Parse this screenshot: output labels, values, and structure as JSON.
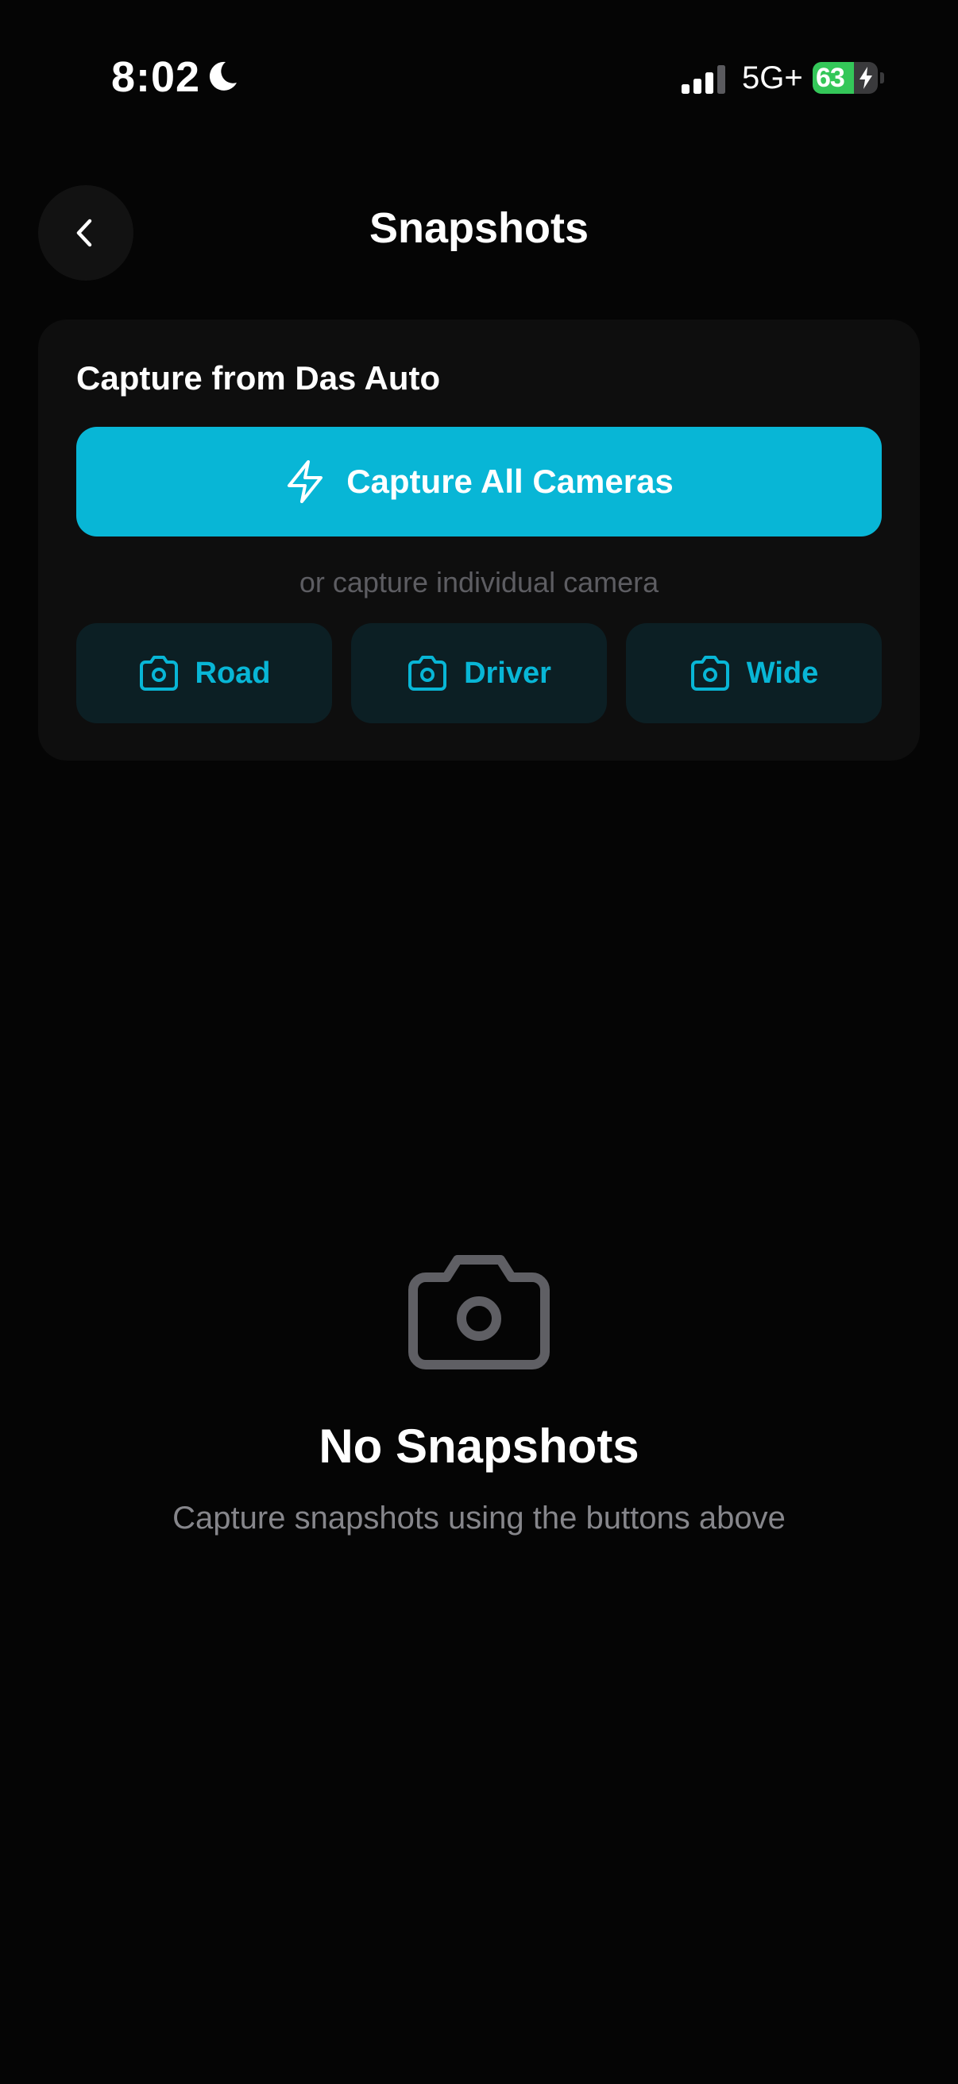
{
  "status_bar": {
    "time": "8:02",
    "network": "5G+",
    "battery_percent": "63",
    "icons": [
      "moon-icon",
      "signal-icon",
      "battery-icon",
      "bolt-icon"
    ]
  },
  "header": {
    "title": "Snapshots",
    "back_icon": "chevron-left-icon"
  },
  "capture_card": {
    "title": "Capture from Das Auto",
    "capture_all_label": "Capture All Cameras",
    "capture_all_icon": "lightning-icon",
    "individual_hint": "or capture individual camera",
    "cameras": [
      {
        "label": "Road",
        "icon": "camera-icon"
      },
      {
        "label": "Driver",
        "icon": "camera-icon"
      },
      {
        "label": "Wide",
        "icon": "camera-icon"
      }
    ]
  },
  "empty_state": {
    "icon": "camera-icon",
    "title": "No Snapshots",
    "subtitle": "Capture snapshots using the buttons above"
  },
  "colors": {
    "background": "#050505",
    "accent": "#08b6d6",
    "card": "#0e0e0e",
    "camera_button_bg": "#0c1f24",
    "battery_green": "#34c759",
    "muted_text": "#86868b"
  }
}
